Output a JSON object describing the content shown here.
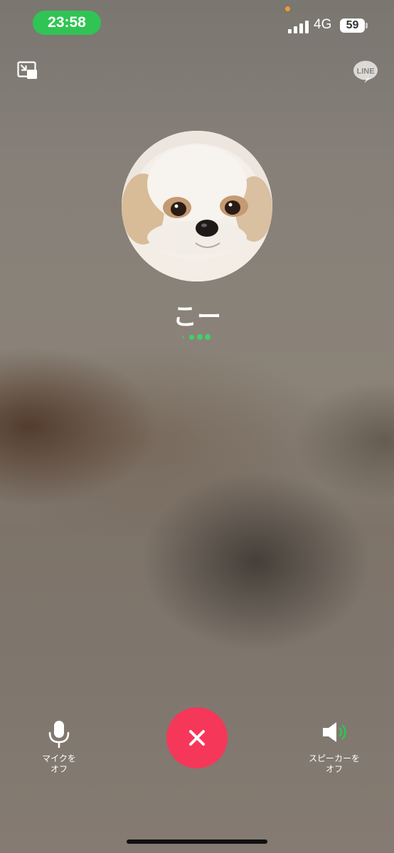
{
  "status_bar": {
    "time": "23:58",
    "network": "4G",
    "battery": "59",
    "colors": {
      "time_pill": "#30c454",
      "privacy_dot": "#f59a2b"
    }
  },
  "top_bar": {
    "minimize_icon": "picture-in-picture-icon",
    "app_logo": {
      "text": "LINE",
      "icon": "line-logo-icon"
    }
  },
  "caller": {
    "name": "こー",
    "avatar": "dog-photo-avatar",
    "calling_indicator_color": "#3fd16a"
  },
  "controls": {
    "mic": {
      "label": "マイクを\nオフ",
      "icon": "microphone-icon"
    },
    "end_call": {
      "icon": "close-icon",
      "color": "#f5375a"
    },
    "speaker": {
      "label": "スピーカーを\nオフ",
      "icon": "speaker-icon",
      "active_color": "#30c454"
    }
  }
}
